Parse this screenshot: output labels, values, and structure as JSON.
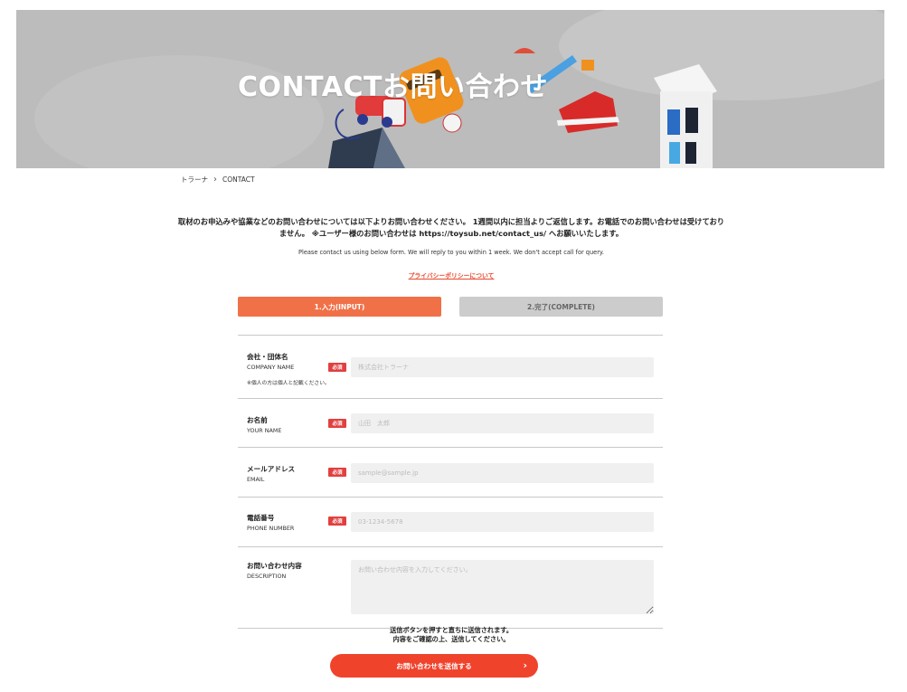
{
  "hero": {
    "title": "CONTACTお問い合わせ"
  },
  "breadcrumb": {
    "home": "トラーナ",
    "current": "CONTACT"
  },
  "intro": {
    "jp": "取材のお申込みや協業などのお問い合わせについては以下よりお問い合わせください。 1週間以内に担当よりご返信します。お電話でのお問い合わせは受けておりません。 ※ユーザー様のお問い合わせは https://toysub.net/contact_us/ へお願いいたします。",
    "en": "Please contact us using below form. We will reply to you within 1 week. We don't accept call for query.",
    "privacy_link": "プライバシーポリシーについて"
  },
  "steps": [
    {
      "label": "1.入力(INPUT)"
    },
    {
      "label": "2.完了(COMPLETE)"
    }
  ],
  "form": {
    "required_badge": "必須",
    "company": {
      "label_jp": "会社・団体名",
      "label_en": "COMPANY NAME",
      "note": "※個人の方は個人と記載ください。",
      "placeholder": "株式会社トラーナ",
      "value": ""
    },
    "name": {
      "label_jp": "お名前",
      "label_en": "YOUR NAME",
      "placeholder": "山田　太郎",
      "value": ""
    },
    "email": {
      "label_jp": "メールアドレス",
      "label_en": "EMAIL",
      "placeholder": "sample@sample.jp",
      "value": ""
    },
    "phone": {
      "label_jp": "電話番号",
      "label_en": "PHONE NUMBER",
      "placeholder": "03-1234-5678",
      "value": ""
    },
    "description": {
      "label_jp": "お問い合わせ内容",
      "label_en": "DESCRIPTION",
      "placeholder": "お問い合わせ内容を入力してください。",
      "value": ""
    }
  },
  "submit": {
    "note_line1": "送信ボタンを押すと直ちに送信されます。",
    "note_line2": "内容をご確認の上、送信してください。",
    "label": "お問い合わせを送信する"
  },
  "colors": {
    "accent": "#f07148",
    "submit": "#f0432c",
    "required": "#e14040",
    "step_inactive": "#cccccc",
    "field_bg": "#f0f0f0"
  }
}
